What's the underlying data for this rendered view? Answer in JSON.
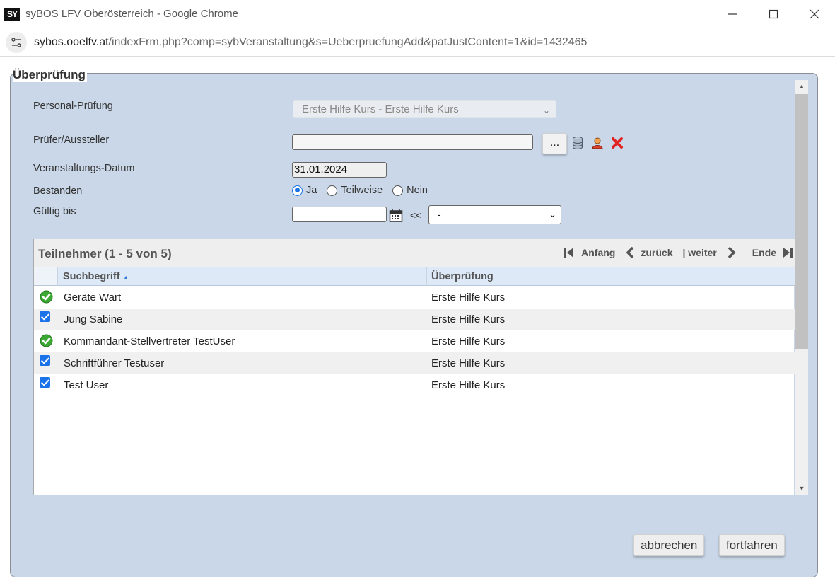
{
  "window": {
    "app_icon_text": "SY",
    "title": "syBOS LFV Oberösterreich - Google Chrome",
    "url_domain": "sybos.ooelfv.at",
    "url_path": "/indexFrm.php?comp=sybVeranstaltung&s=UeberpruefungAdd&patJustContent=1&id=1432465"
  },
  "form": {
    "legend": "Überprüfung",
    "personal_pruefung_label": "Personal-Prüfung",
    "personal_pruefung_value": "Erste Hilfe Kurs - Erste Hilfe Kurs",
    "pruefer_label": "Prüfer/Aussteller",
    "pruefer_value": "",
    "pruefer_button": "...",
    "datum_label": "Veranstaltungs-Datum",
    "datum_value": "31.01.2024",
    "bestanden_label": "Bestanden",
    "bestanden_options": [
      "Ja",
      "Teilweise",
      "Nein"
    ],
    "bestanden_selected": "Ja",
    "gueltig_label": "Gültig bis",
    "gueltig_value": "",
    "gueltig_arrow": "<<",
    "gueltig_select": "-"
  },
  "grid": {
    "title": "Teilnehmer (1 - 5 von 5)",
    "pager": {
      "first": "Anfang",
      "prev": "zurück",
      "next": "| weiter",
      "last": "Ende"
    },
    "columns": [
      "Suchbegriff",
      "Überprüfung"
    ],
    "rows": [
      {
        "marker": "ok",
        "name": "Geräte Wart",
        "check": "Erste Hilfe Kurs"
      },
      {
        "marker": "checkbox",
        "name": "Jung Sabine",
        "check": "Erste Hilfe Kurs"
      },
      {
        "marker": "ok",
        "name": "Kommandant-Stellvertreter TestUser",
        "check": "Erste Hilfe Kurs"
      },
      {
        "marker": "checkbox",
        "name": "Schriftführer Testuser",
        "check": "Erste Hilfe Kurs"
      },
      {
        "marker": "checkbox",
        "name": "Test User",
        "check": "Erste Hilfe Kurs"
      }
    ]
  },
  "actions": {
    "cancel": "abbrechen",
    "continue": "fortfahren"
  },
  "colors": {
    "panel_bg": "#c9d7e8",
    "accent": "#1a73e8",
    "ok_green": "#3aa832",
    "delete_red": "#e02424"
  }
}
